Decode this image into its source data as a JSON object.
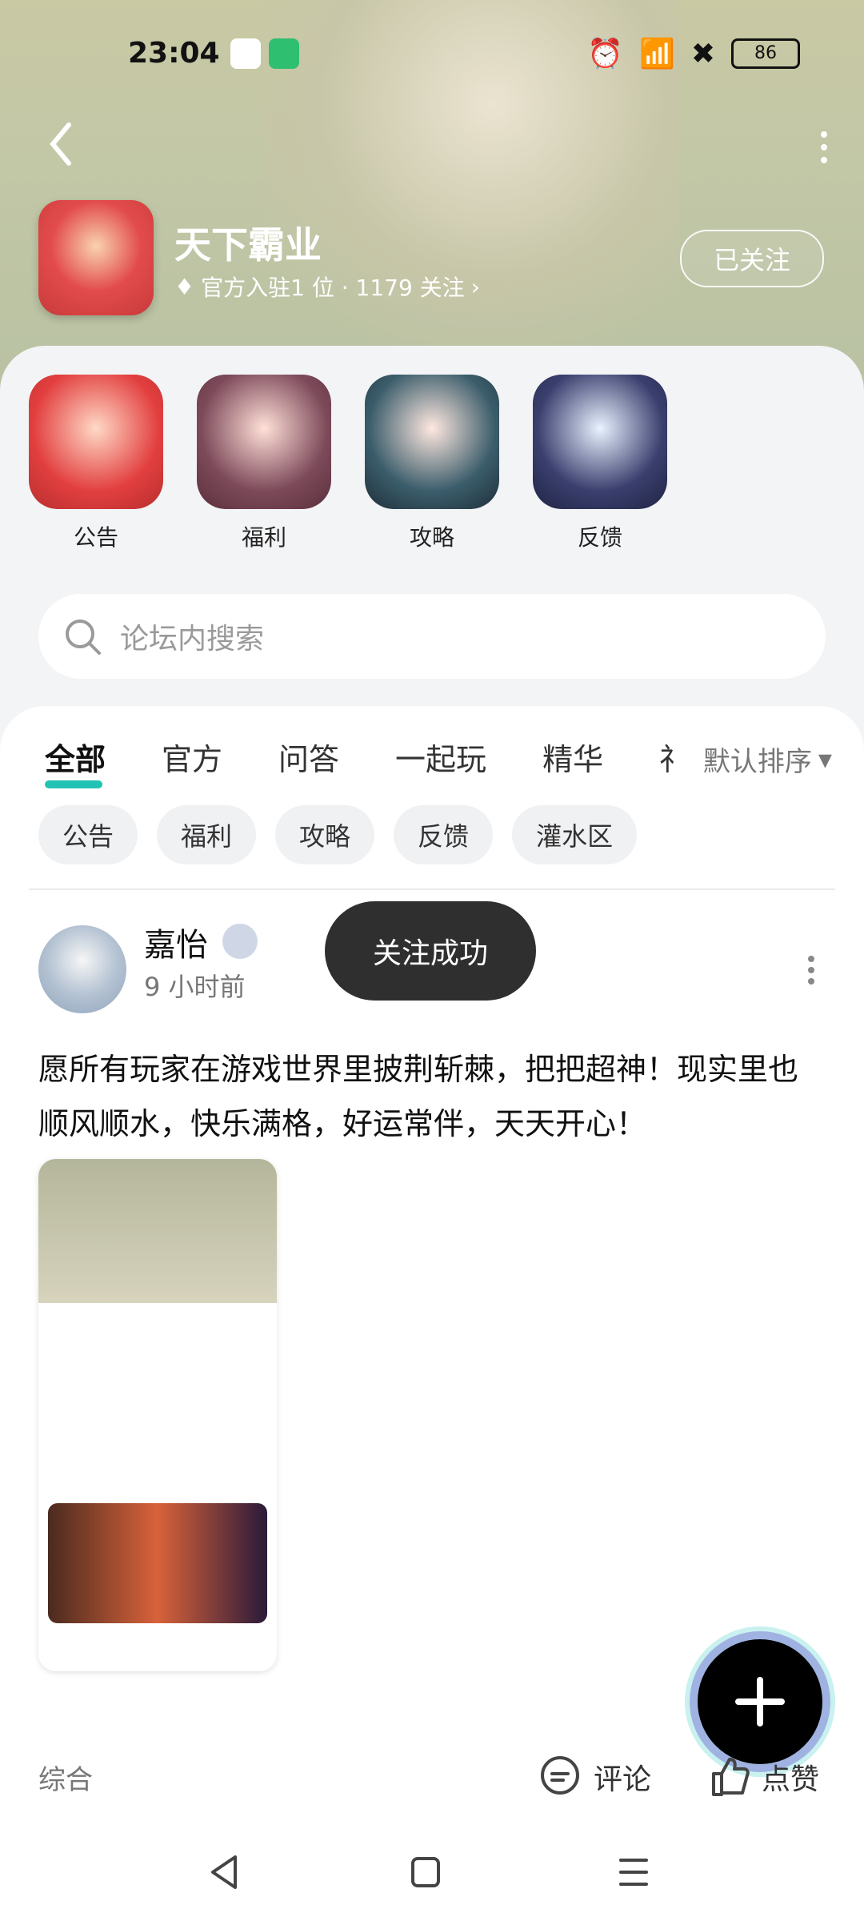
{
  "status": {
    "time": "23:04",
    "battery": "86"
  },
  "header": {
    "title": "天下霸业",
    "meta": "官方入驻1 位 · 1179 关注",
    "follow_label": "已关注"
  },
  "quick": [
    {
      "label": "公告"
    },
    {
      "label": "福利"
    },
    {
      "label": "攻略"
    },
    {
      "label": "反馈"
    }
  ],
  "search": {
    "placeholder": "论坛内搜索"
  },
  "tabs": [
    "全部",
    "官方",
    "问答",
    "一起玩",
    "精华",
    "礼"
  ],
  "sort": {
    "label": "默认排序"
  },
  "chips": [
    "公告",
    "福利",
    "攻略",
    "反馈",
    "灌水区"
  ],
  "post": {
    "author": "嘉怡",
    "time": "9 小时前",
    "text": "愿所有玩家在游戏世界里披荆斩棘，把把超神！现实里也顺风顺水，快乐满格，好运常伴，天天开心！"
  },
  "toast": "关注成功",
  "bottom": {
    "left": "综合",
    "comment": "评论",
    "like": "点赞"
  }
}
